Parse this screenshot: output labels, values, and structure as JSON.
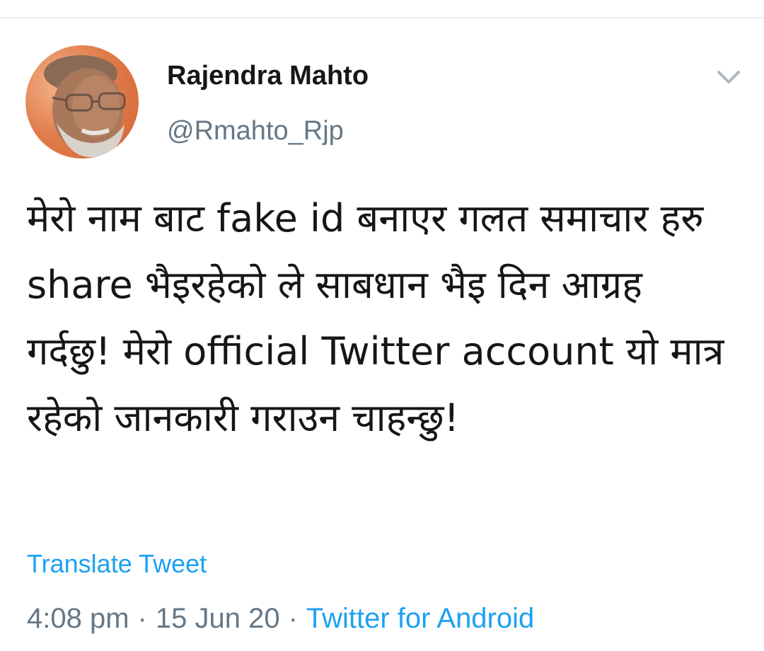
{
  "author": {
    "display_name": "Rajendra Mahto",
    "handle": "@Rmahto_Rjp"
  },
  "icons": {
    "avatar": "profile-photo",
    "menu": "chevron-down-icon"
  },
  "tweet": {
    "text": "मेरो नाम बाट fake id बनाएर गलत समाचार हरु share भैइरहेको ले साबधान भैइ दिन आग्रह गर्दछु! मेरो official Twitter account यो मात्र रहेको जानकारी गराउन चाहन्छु!",
    "translate_label": "Translate Tweet"
  },
  "meta": {
    "time": "4:08 pm",
    "separator": "·",
    "date": "15 Jun 20",
    "source": "Twitter for Android"
  },
  "colors": {
    "link": "#1da1f2",
    "secondary_text": "#657786",
    "primary_text": "#14171a"
  }
}
